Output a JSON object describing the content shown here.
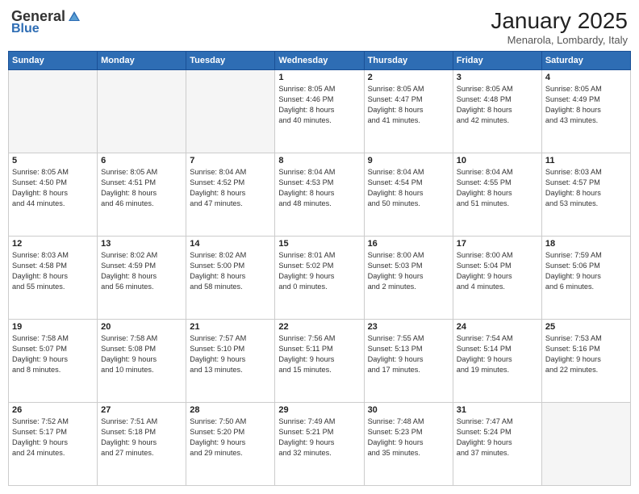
{
  "logo": {
    "general": "General",
    "blue": "Blue"
  },
  "header": {
    "month": "January 2025",
    "location": "Menarola, Lombardy, Italy"
  },
  "days_of_week": [
    "Sunday",
    "Monday",
    "Tuesday",
    "Wednesday",
    "Thursday",
    "Friday",
    "Saturday"
  ],
  "weeks": [
    [
      {
        "day": "",
        "info": ""
      },
      {
        "day": "",
        "info": ""
      },
      {
        "day": "",
        "info": ""
      },
      {
        "day": "1",
        "info": "Sunrise: 8:05 AM\nSunset: 4:46 PM\nDaylight: 8 hours\nand 40 minutes."
      },
      {
        "day": "2",
        "info": "Sunrise: 8:05 AM\nSunset: 4:47 PM\nDaylight: 8 hours\nand 41 minutes."
      },
      {
        "day": "3",
        "info": "Sunrise: 8:05 AM\nSunset: 4:48 PM\nDaylight: 8 hours\nand 42 minutes."
      },
      {
        "day": "4",
        "info": "Sunrise: 8:05 AM\nSunset: 4:49 PM\nDaylight: 8 hours\nand 43 minutes."
      }
    ],
    [
      {
        "day": "5",
        "info": "Sunrise: 8:05 AM\nSunset: 4:50 PM\nDaylight: 8 hours\nand 44 minutes."
      },
      {
        "day": "6",
        "info": "Sunrise: 8:05 AM\nSunset: 4:51 PM\nDaylight: 8 hours\nand 46 minutes."
      },
      {
        "day": "7",
        "info": "Sunrise: 8:04 AM\nSunset: 4:52 PM\nDaylight: 8 hours\nand 47 minutes."
      },
      {
        "day": "8",
        "info": "Sunrise: 8:04 AM\nSunset: 4:53 PM\nDaylight: 8 hours\nand 48 minutes."
      },
      {
        "day": "9",
        "info": "Sunrise: 8:04 AM\nSunset: 4:54 PM\nDaylight: 8 hours\nand 50 minutes."
      },
      {
        "day": "10",
        "info": "Sunrise: 8:04 AM\nSunset: 4:55 PM\nDaylight: 8 hours\nand 51 minutes."
      },
      {
        "day": "11",
        "info": "Sunrise: 8:03 AM\nSunset: 4:57 PM\nDaylight: 8 hours\nand 53 minutes."
      }
    ],
    [
      {
        "day": "12",
        "info": "Sunrise: 8:03 AM\nSunset: 4:58 PM\nDaylight: 8 hours\nand 55 minutes."
      },
      {
        "day": "13",
        "info": "Sunrise: 8:02 AM\nSunset: 4:59 PM\nDaylight: 8 hours\nand 56 minutes."
      },
      {
        "day": "14",
        "info": "Sunrise: 8:02 AM\nSunset: 5:00 PM\nDaylight: 8 hours\nand 58 minutes."
      },
      {
        "day": "15",
        "info": "Sunrise: 8:01 AM\nSunset: 5:02 PM\nDaylight: 9 hours\nand 0 minutes."
      },
      {
        "day": "16",
        "info": "Sunrise: 8:00 AM\nSunset: 5:03 PM\nDaylight: 9 hours\nand 2 minutes."
      },
      {
        "day": "17",
        "info": "Sunrise: 8:00 AM\nSunset: 5:04 PM\nDaylight: 9 hours\nand 4 minutes."
      },
      {
        "day": "18",
        "info": "Sunrise: 7:59 AM\nSunset: 5:06 PM\nDaylight: 9 hours\nand 6 minutes."
      }
    ],
    [
      {
        "day": "19",
        "info": "Sunrise: 7:58 AM\nSunset: 5:07 PM\nDaylight: 9 hours\nand 8 minutes."
      },
      {
        "day": "20",
        "info": "Sunrise: 7:58 AM\nSunset: 5:08 PM\nDaylight: 9 hours\nand 10 minutes."
      },
      {
        "day": "21",
        "info": "Sunrise: 7:57 AM\nSunset: 5:10 PM\nDaylight: 9 hours\nand 13 minutes."
      },
      {
        "day": "22",
        "info": "Sunrise: 7:56 AM\nSunset: 5:11 PM\nDaylight: 9 hours\nand 15 minutes."
      },
      {
        "day": "23",
        "info": "Sunrise: 7:55 AM\nSunset: 5:13 PM\nDaylight: 9 hours\nand 17 minutes."
      },
      {
        "day": "24",
        "info": "Sunrise: 7:54 AM\nSunset: 5:14 PM\nDaylight: 9 hours\nand 19 minutes."
      },
      {
        "day": "25",
        "info": "Sunrise: 7:53 AM\nSunset: 5:16 PM\nDaylight: 9 hours\nand 22 minutes."
      }
    ],
    [
      {
        "day": "26",
        "info": "Sunrise: 7:52 AM\nSunset: 5:17 PM\nDaylight: 9 hours\nand 24 minutes."
      },
      {
        "day": "27",
        "info": "Sunrise: 7:51 AM\nSunset: 5:18 PM\nDaylight: 9 hours\nand 27 minutes."
      },
      {
        "day": "28",
        "info": "Sunrise: 7:50 AM\nSunset: 5:20 PM\nDaylight: 9 hours\nand 29 minutes."
      },
      {
        "day": "29",
        "info": "Sunrise: 7:49 AM\nSunset: 5:21 PM\nDaylight: 9 hours\nand 32 minutes."
      },
      {
        "day": "30",
        "info": "Sunrise: 7:48 AM\nSunset: 5:23 PM\nDaylight: 9 hours\nand 35 minutes."
      },
      {
        "day": "31",
        "info": "Sunrise: 7:47 AM\nSunset: 5:24 PM\nDaylight: 9 hours\nand 37 minutes."
      },
      {
        "day": "",
        "info": ""
      }
    ]
  ]
}
